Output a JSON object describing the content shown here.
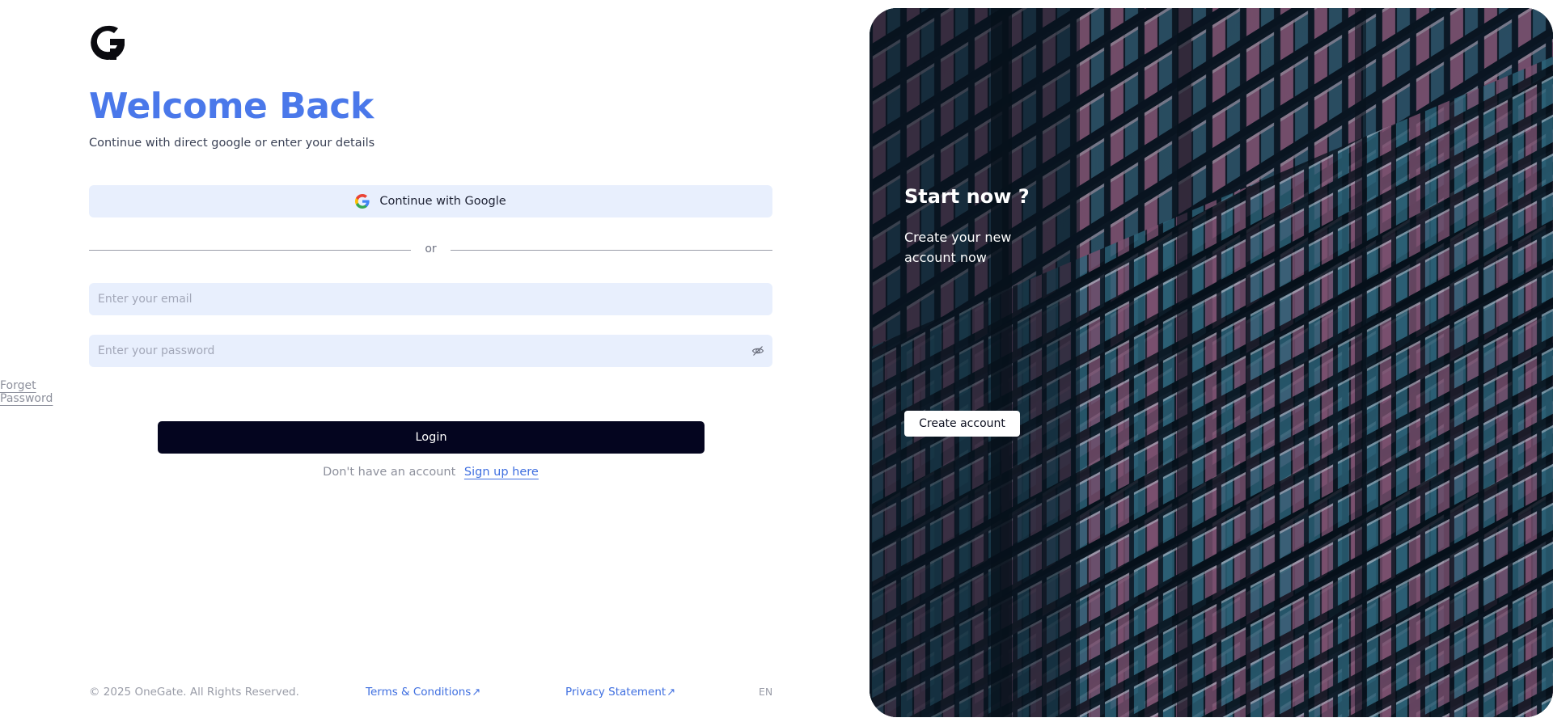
{
  "brand": {
    "logo_icon": "onegate-g-logo-icon"
  },
  "login": {
    "title": "Welcome Back",
    "subtitle": "Continue with direct google or enter your details",
    "google_button": "Continue with Google",
    "divider_text": "or",
    "email_placeholder": "Enter your email",
    "password_placeholder": "Enter your password",
    "forget_password": "Forget Password",
    "login_button": "Login",
    "no_account_text": "Don't have an account",
    "signup_link": "Sign up here"
  },
  "footer": {
    "copyright": "© 2025 OneGate. All Rights Reserved.",
    "terms": "Terms & Conditions",
    "privacy": "Privacy Statement",
    "external_arrow": "↗",
    "language": "EN"
  },
  "hero": {
    "title": "Start now ?",
    "text": "Create your new account now",
    "button": "Create account"
  },
  "colors": {
    "accent": "#4a78ea",
    "link": "#3f6fe0",
    "field_bg": "#e8effd",
    "login_bg": "#04051f"
  }
}
